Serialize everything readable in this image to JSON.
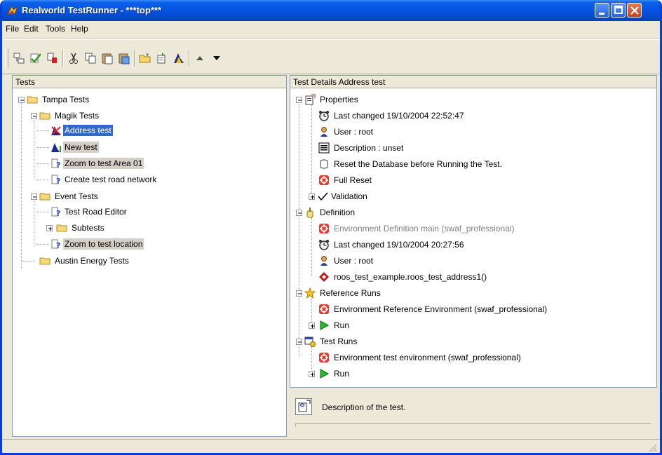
{
  "window": {
    "title": "Realworld TestRunner - ***top***",
    "title_color": "#ffffff",
    "titlebar_color": "#0553e0"
  },
  "menu": [
    "File",
    "Edit",
    "Tools",
    "Help"
  ],
  "toolbar": {
    "buttons": [
      "new-test-icon",
      "validate-icon",
      "delete-test-icon",
      "cut-icon",
      "copy-icon",
      "paste-icon",
      "paste-special-icon",
      "open-folder-icon",
      "import-icon",
      "run-tests-icon",
      "move-up-icon",
      "move-down-icon"
    ]
  },
  "tests_panel": {
    "header": "Tests",
    "items": [
      {
        "label": "Tampa Tests",
        "icon": "folder-icon"
      },
      {
        "label": "Magik Tests",
        "icon": "folder-icon"
      },
      {
        "label": "Address test",
        "icon": "test-failed-icon",
        "selected": true
      },
      {
        "label": "New test",
        "icon": "test-new-icon"
      },
      {
        "label": "Zoom to test Area 01",
        "icon": "test-unknown-icon"
      },
      {
        "label": "Create test road network",
        "icon": "test-unknown-icon"
      },
      {
        "label": "Event Tests",
        "icon": "folder-icon"
      },
      {
        "label": "Test Road Editor",
        "icon": "test-unknown-icon"
      },
      {
        "label": "Subtests",
        "icon": "folder-icon"
      },
      {
        "label": "Zoom to test location",
        "icon": "test-unknown-icon"
      },
      {
        "label": "Austin Energy Tests",
        "icon": "folder-icon"
      }
    ]
  },
  "details_panel": {
    "header": "Test Details Address test",
    "items": [
      {
        "label": "Properties",
        "icon": "properties-icon"
      },
      {
        "label": "Last changed 19/10/2004 22:52:47",
        "icon": "clock-icon"
      },
      {
        "label": "User : root",
        "icon": "user-icon"
      },
      {
        "label": "Description : unset",
        "icon": "document-icon"
      },
      {
        "label": "Reset the Database before Running the Test.",
        "icon": "database-icon"
      },
      {
        "label": "Full Reset",
        "icon": "reset-icon"
      },
      {
        "label": "Validation",
        "icon": "checkmark-icon"
      },
      {
        "label": "Definition",
        "icon": "definition-icon"
      },
      {
        "label": "Environment Definition main (swaf_professional)",
        "icon": "environment-icon"
      },
      {
        "label": "Last changed 19/10/2004 20:27:56",
        "icon": "clock-icon"
      },
      {
        "label": "User : root",
        "icon": "user-icon"
      },
      {
        "label": "roos_test_example.roos_test_address1()",
        "icon": "method-icon"
      },
      {
        "label": "Reference Runs",
        "icon": "star-icon"
      },
      {
        "label": "Environment Reference Environment (swaf_professional)",
        "icon": "environment-icon"
      },
      {
        "label": "Run",
        "icon": "run-icon"
      },
      {
        "label": "Test Runs",
        "icon": "test-runs-icon"
      },
      {
        "label": "Environment test environment (swaf_professional)",
        "icon": "environment-icon"
      },
      {
        "label": "Run",
        "icon": "run-icon"
      }
    ]
  },
  "description_panel": {
    "text": "Description of the test.",
    "icon": "edit-description-icon"
  }
}
